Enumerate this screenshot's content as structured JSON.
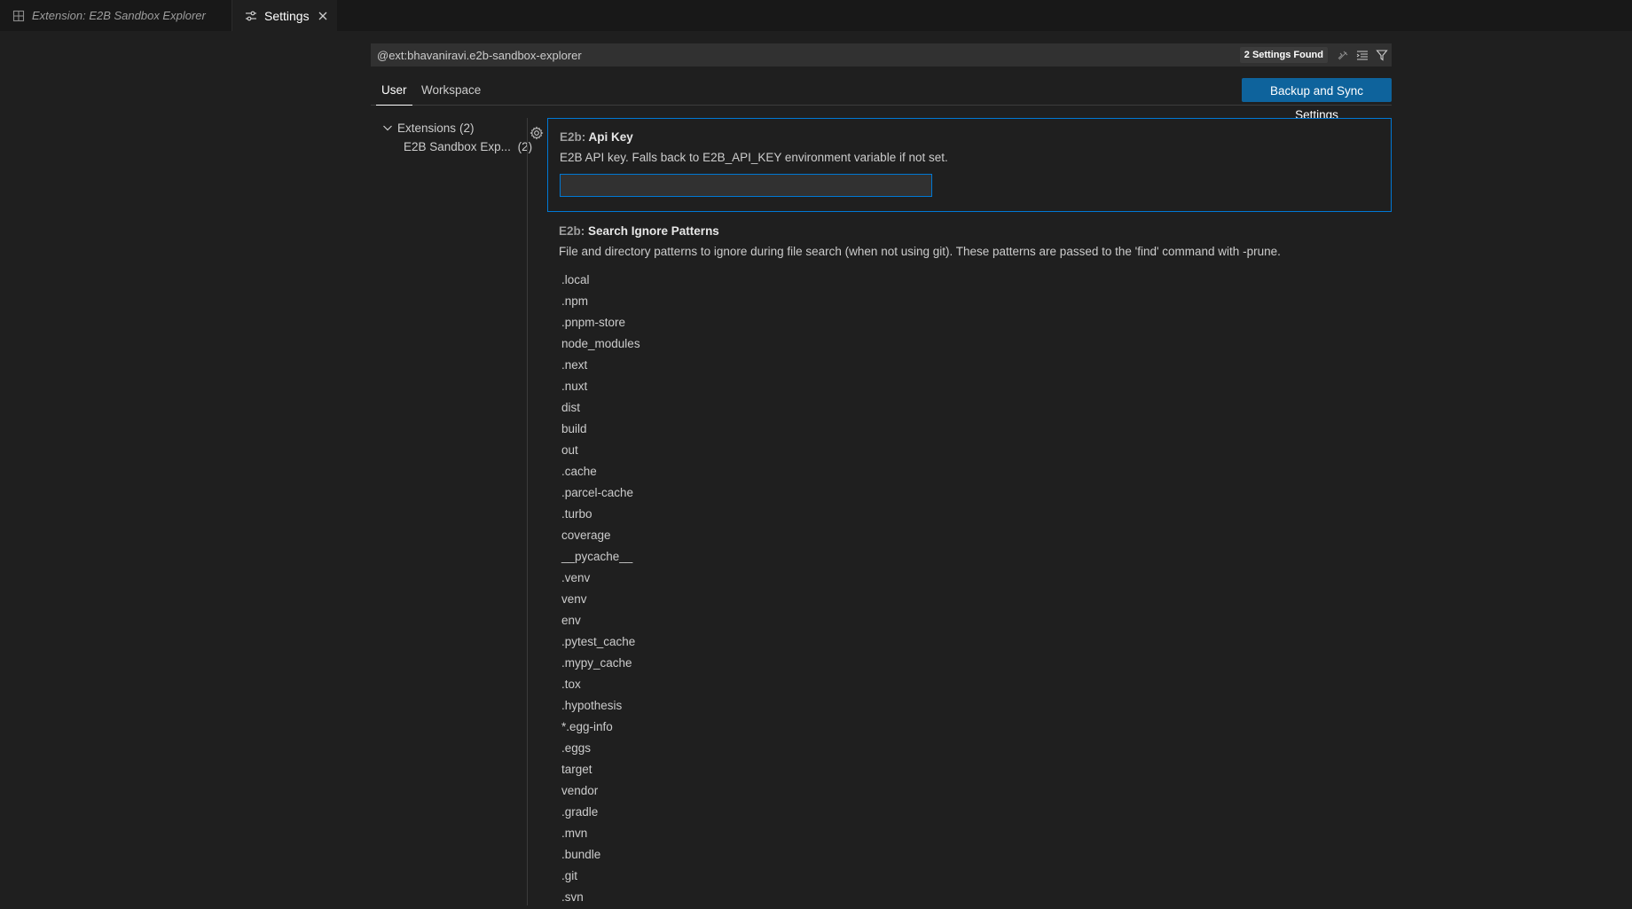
{
  "tabs": [
    {
      "label": "Extension: E2B Sandbox Explorer",
      "active": false,
      "icon": "extension-icon"
    },
    {
      "label": "Settings",
      "active": true,
      "icon": "settings-sliders-icon"
    }
  ],
  "search": {
    "query": "@ext:bhavaniravi.e2b-sandbox-explorer",
    "results_count": "2 Settings Found",
    "icons": [
      "clear-filter-icon",
      "collapse-all-icon",
      "filter-icon"
    ]
  },
  "scope_tabs": {
    "user": "User",
    "workspace": "Workspace",
    "active": "User"
  },
  "sync_button": "Backup and Sync Settings",
  "toc": {
    "group_label": "Extensions",
    "group_count": "(2)",
    "child_label": "E2B Sandbox Exp...",
    "child_count": "(2)"
  },
  "settings": {
    "api_key": {
      "category": "E2b: ",
      "name": "Api Key",
      "description": "E2B API key. Falls back to E2B_API_KEY environment variable if not set.",
      "value": ""
    },
    "search_ignore": {
      "category": "E2b: ",
      "name": "Search Ignore Patterns",
      "description": "File and directory patterns to ignore during file search (when not using git). These patterns are passed to the 'find' command with -prune.",
      "patterns": [
        ".local",
        ".npm",
        ".pnpm-store",
        "node_modules",
        ".next",
        ".nuxt",
        "dist",
        "build",
        "out",
        ".cache",
        ".parcel-cache",
        ".turbo",
        "coverage",
        "__pycache__",
        ".venv",
        "venv",
        "env",
        ".pytest_cache",
        ".mypy_cache",
        ".tox",
        ".hypothesis",
        "*.egg-info",
        ".eggs",
        "target",
        "vendor",
        ".gradle",
        ".mvn",
        ".bundle",
        ".git",
        ".svn"
      ]
    }
  }
}
